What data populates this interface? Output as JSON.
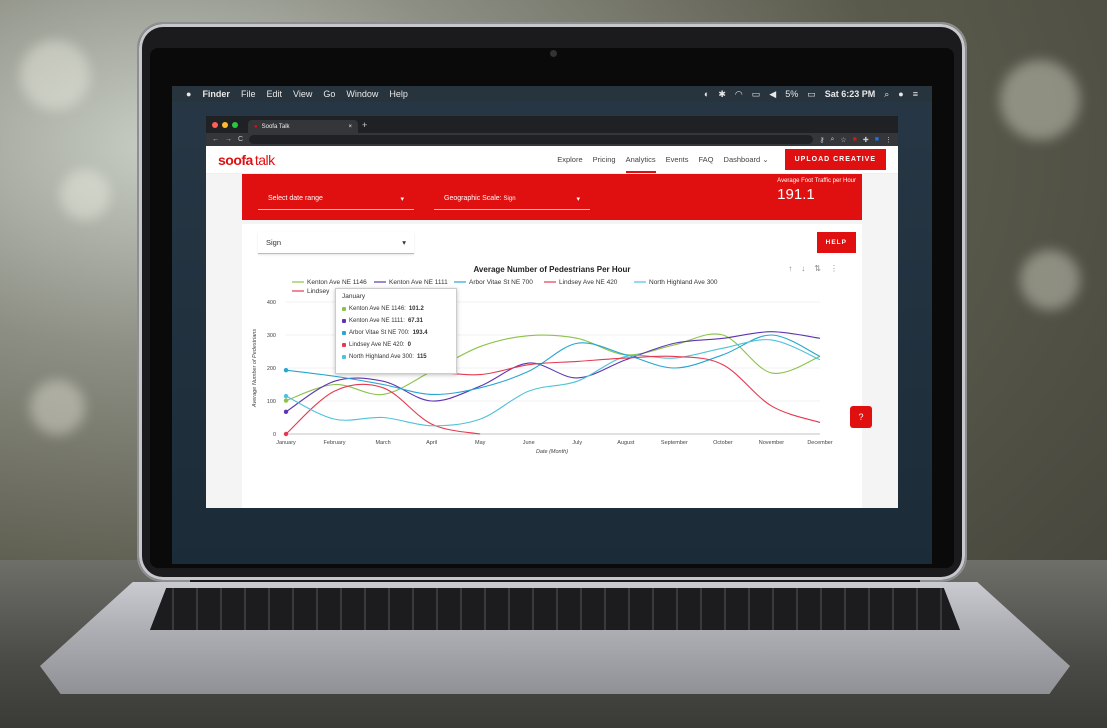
{
  "menubar": {
    "apple": "",
    "items": [
      "Finder",
      "File",
      "Edit",
      "View",
      "Go",
      "Window",
      "Help"
    ],
    "battery": "5%",
    "clock": "Sat 6:23 PM"
  },
  "browser": {
    "tab_title": "Soofa Talk",
    "tab_close": "×",
    "new_tab": "+"
  },
  "site": {
    "logo_brand": "soofa",
    "logo_product": "talk",
    "nav": [
      "Explore",
      "Pricing",
      "Analytics",
      "Events",
      "FAQ",
      "Dashboard"
    ],
    "dashboard_caret": "⌄",
    "upload": "UPLOAD CREATIVE"
  },
  "filters": {
    "date_range": "Select date range",
    "geo_label": "Geographic Scale:",
    "geo_value": "Sign",
    "caret": "▾"
  },
  "kpi": {
    "label": "Average Foot Traffic per Hour",
    "value": "191.1"
  },
  "card": {
    "sign_select": "Sign",
    "help": "HELP",
    "chat_icon": "?"
  },
  "colors": {
    "brand": "#e01010",
    "kenton1146": "#8bc34a",
    "kenton1111": "#5e35b1",
    "arbor": "#26a6d1",
    "lindsey": "#e53950",
    "highland": "#4fc3d9"
  },
  "tooltip": {
    "title": "January",
    "rows": [
      {
        "name": "Kenton Ave NE 1146:",
        "value": "101.2"
      },
      {
        "name": "Kenton Ave NE 1111:",
        "value": "67.31"
      },
      {
        "name": "Arbor Vitae St NE 700:",
        "value": "193.4"
      },
      {
        "name": "Lindsey Ave NE 420:",
        "value": "0"
      },
      {
        "name": "North Highland Ave 300:",
        "value": "115"
      }
    ]
  },
  "chart_data": {
    "type": "line",
    "title": "Average Number of Pedestrians Per Hour",
    "xlabel": "Date (Month)",
    "ylabel": "Average Number of Pedestrians",
    "ylim": [
      0,
      400
    ],
    "yticks": [
      0,
      100,
      200,
      300,
      400
    ],
    "grid": true,
    "legend_position": "top",
    "categories": [
      "January",
      "February",
      "March",
      "April",
      "May",
      "June",
      "July",
      "August",
      "September",
      "October",
      "November",
      "December"
    ],
    "series": [
      {
        "name": "Kenton Ave NE 1146",
        "values": [
          101.2,
          150,
          120,
          190,
          265,
          298,
          290,
          240,
          270,
          300,
          185,
          235
        ]
      },
      {
        "name": "Kenton Ave NE 1111",
        "values": [
          67.31,
          160,
          160,
          100,
          145,
          215,
          170,
          225,
          275,
          290,
          310,
          290
        ]
      },
      {
        "name": "Arbor Vitae St NE 700",
        "values": [
          193.4,
          175,
          150,
          120,
          140,
          190,
          275,
          240,
          200,
          240,
          300,
          235
        ]
      },
      {
        "name": "Lindsey Ave NE 420",
        "values": [
          0,
          130,
          140,
          30,
          0,
          null,
          null,
          null,
          null,
          null,
          null,
          null
        ]
      },
      {
        "name": "North Highland Ave 300",
        "values": [
          115,
          45,
          50,
          25,
          45,
          130,
          160,
          235,
          230,
          260,
          285,
          225
        ]
      },
      {
        "name": "Lindsey",
        "values": [
          null,
          null,
          null,
          190,
          180,
          210,
          220,
          230,
          235,
          210,
          85,
          35
        ]
      }
    ]
  }
}
